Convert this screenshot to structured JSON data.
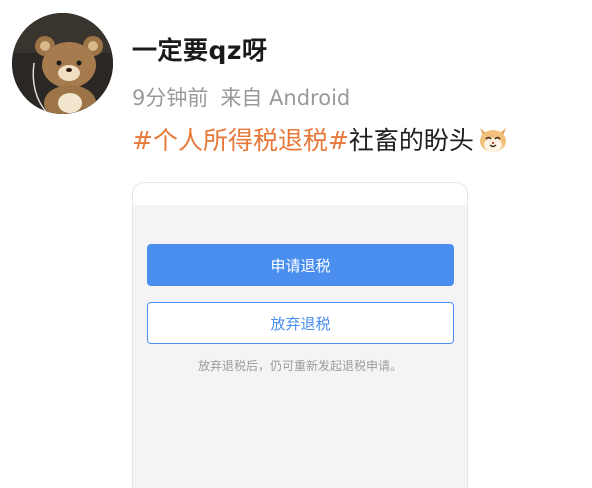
{
  "post": {
    "username": "一定要qz呀",
    "time": "9分钟前",
    "source": "来自 Android",
    "topic": "#个人所得税退税#",
    "text": "社畜的盼头",
    "emoji_icon": "cat-face-emoji-icon"
  },
  "tax_refund_screen": {
    "apply_button_label": "申请退税",
    "abandon_button_label": "放弃退税",
    "hint_text": "放弃退税后，仍可重新发起退税申请。",
    "colors": {
      "primary": "#4a8ef0",
      "topic_link": "#e8793a"
    }
  }
}
